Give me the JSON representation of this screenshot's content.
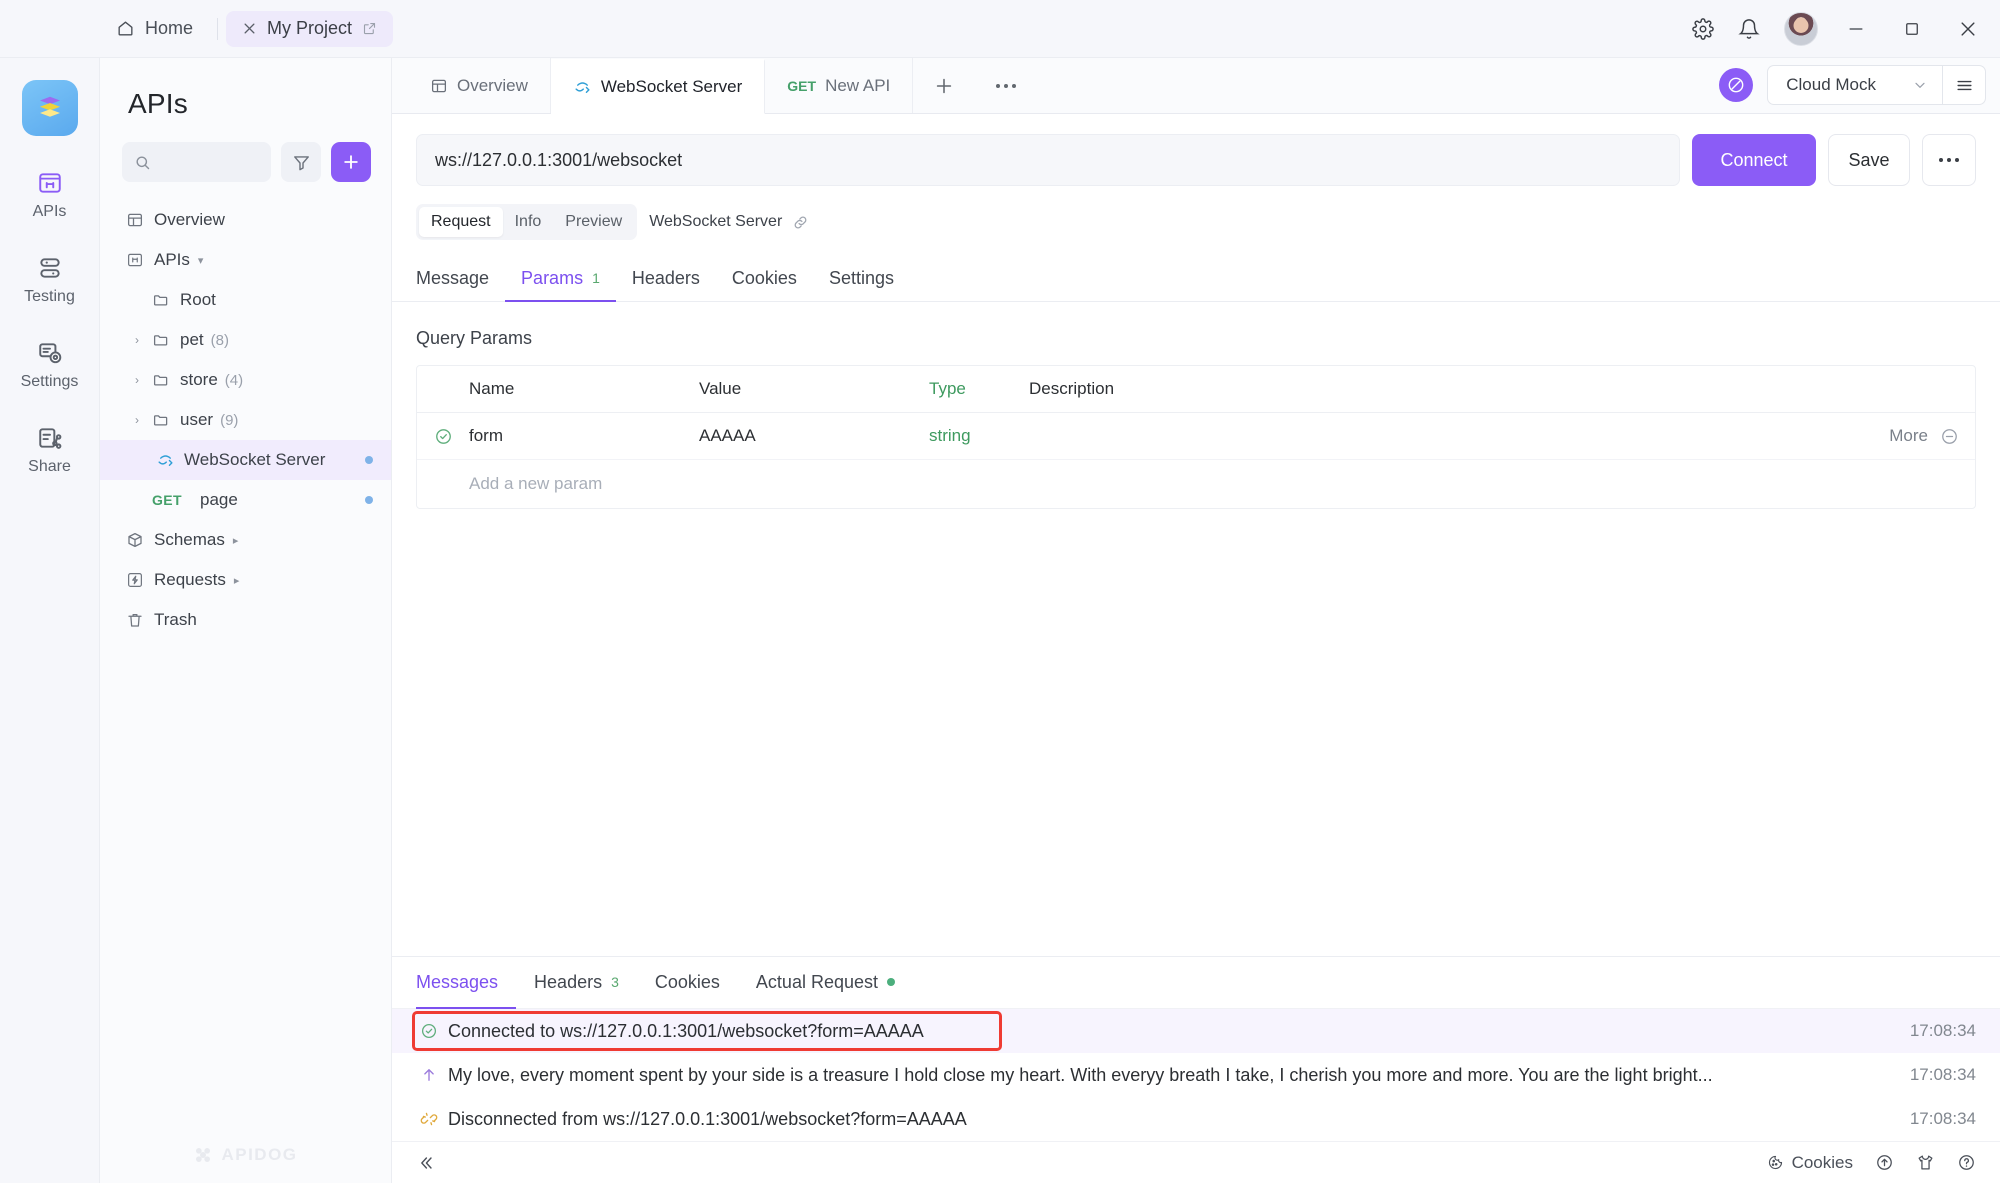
{
  "titlebar": {
    "home_label": "Home",
    "project_label": "My Project",
    "icons": {
      "home": "home-icon",
      "close_tab": "close-icon",
      "external_link": "external-link-icon",
      "settings": "gear-icon",
      "notifications": "bell-icon",
      "avatar": "user-avatar",
      "minimize": "minimize-icon",
      "maximize": "maximize-icon",
      "close": "close-icon"
    }
  },
  "rail": {
    "logo": "apidog-logo",
    "items": [
      {
        "label": "APIs",
        "icon": "apis-icon",
        "active": true
      },
      {
        "label": "Testing",
        "icon": "testing-icon",
        "active": false
      },
      {
        "label": "Settings",
        "icon": "settings-icon",
        "active": false
      },
      {
        "label": "Share",
        "icon": "share-icon",
        "active": false
      }
    ]
  },
  "sidebar": {
    "title": "APIs",
    "search_placeholder": "",
    "search_value": "",
    "filter_icon": "filter-icon",
    "add_icon": "plus-icon",
    "watermark": "APIDOG",
    "tree": [
      {
        "label": "Overview",
        "icon": "overview-icon",
        "indent": 0,
        "caret": "",
        "count": "",
        "selected": false,
        "dot": false
      },
      {
        "label": "APIs",
        "icon": "apis-icon",
        "indent": 0,
        "caret": "down-small",
        "count": "",
        "selected": false,
        "dot": false
      },
      {
        "label": "Root",
        "icon": "folder-icon",
        "indent": 1,
        "caret": "",
        "count": "",
        "selected": false,
        "dot": false
      },
      {
        "label": "pet",
        "icon": "folder-icon",
        "indent": 1,
        "caret": "right",
        "count": "(8)",
        "selected": false,
        "dot": false
      },
      {
        "label": "store",
        "icon": "folder-icon",
        "indent": 1,
        "caret": "right",
        "count": "(4)",
        "selected": false,
        "dot": false
      },
      {
        "label": "user",
        "icon": "folder-icon",
        "indent": 1,
        "caret": "right",
        "count": "(9)",
        "selected": false,
        "dot": false
      },
      {
        "label": "WebSocket Server",
        "icon": "websocket-icon",
        "indent": 2,
        "caret": "",
        "count": "",
        "selected": true,
        "dot": true
      },
      {
        "label": "page",
        "icon": "method-get",
        "indent": 2,
        "caret": "",
        "count": "",
        "selected": false,
        "dot": true,
        "method": "GET"
      },
      {
        "label": "Schemas",
        "icon": "schemas-icon",
        "indent": 0,
        "caret": "",
        "count": "",
        "selected": false,
        "dot": false,
        "arrow": "right-small"
      },
      {
        "label": "Requests",
        "icon": "requests-icon",
        "indent": 0,
        "caret": "",
        "count": "",
        "selected": false,
        "dot": false,
        "arrow": "right-small"
      },
      {
        "label": "Trash",
        "icon": "trash-icon",
        "indent": 0,
        "caret": "",
        "count": "",
        "selected": false,
        "dot": false
      }
    ]
  },
  "tabbar": {
    "tabs": [
      {
        "label": "Overview",
        "icon": "overview-icon",
        "method": "",
        "active": false
      },
      {
        "label": "WebSocket Server",
        "icon": "websocket-icon",
        "method": "",
        "active": true
      },
      {
        "label": "New API",
        "icon": "",
        "method": "GET",
        "active": false
      }
    ],
    "plus_icon": "plus-icon",
    "more_icon": "more-horizontal-icon",
    "mock_badge_icon": "mock-icon",
    "mock_label": "Cloud Mock",
    "mock_chevron": "chevron-down-icon",
    "menu_icon": "hamburger-icon"
  },
  "urlbar": {
    "url": "ws://127.0.0.1:3001/websocket",
    "url_placeholder": "ws://",
    "connect_label": "Connect",
    "save_label": "Save",
    "more_icon": "more-horizontal-icon"
  },
  "segmented": {
    "items": [
      {
        "label": "Request",
        "active": true
      },
      {
        "label": "Info",
        "active": false
      },
      {
        "label": "Preview",
        "active": false
      }
    ],
    "name": "WebSocket Server",
    "link_icon": "link-icon"
  },
  "subtabs": [
    {
      "label": "Message",
      "count": "",
      "active": false
    },
    {
      "label": "Params",
      "count": "1",
      "active": true
    },
    {
      "label": "Headers",
      "count": "",
      "active": false
    },
    {
      "label": "Cookies",
      "count": "",
      "active": false
    },
    {
      "label": "Settings",
      "count": "",
      "active": false
    }
  ],
  "params": {
    "section_title": "Query Params",
    "columns": [
      "Name",
      "Value",
      "Type",
      "Description"
    ],
    "rows": [
      {
        "checked": true,
        "check_icon": "check-circle-icon",
        "name": "form",
        "value": "AAAAA",
        "type": "string",
        "description": "",
        "more_label": "More",
        "remove_icon": "minus-circle-icon"
      }
    ],
    "add_row_placeholder": "Add a new param"
  },
  "bottom": {
    "tabs": [
      {
        "label": "Messages",
        "count": "",
        "dot": false,
        "active": true
      },
      {
        "label": "Headers",
        "count": "3",
        "dot": false,
        "active": false
      },
      {
        "label": "Cookies",
        "count": "",
        "dot": false,
        "active": false
      },
      {
        "label": "Actual Request",
        "count": "",
        "dot": true,
        "active": false
      }
    ],
    "messages": [
      {
        "icon": "check-circle-icon",
        "text": "Connected to ws://127.0.0.1:3001/websocket?form=AAAAA",
        "time": "17:08:34",
        "highlighted": true
      },
      {
        "icon": "arrow-up-icon",
        "text": "My love, every moment spent by your side is a treasure I hold close my heart. With everyy breath I take, I cherish you more and more. You are the light bright...",
        "time": "17:08:34",
        "highlighted": false
      },
      {
        "icon": "disconnected-icon",
        "text": "Disconnected from ws://127.0.0.1:3001/websocket?form=AAAAA",
        "time": "17:08:34",
        "highlighted": false
      }
    ]
  },
  "statusbar": {
    "collapse_icon": "collapse-left-icon",
    "cookies_label": "Cookies",
    "cookies_icon": "cookie-icon",
    "upload_icon": "upload-circle-icon",
    "shirt_icon": "theme-shirt-icon",
    "help_icon": "help-circle-icon"
  },
  "colors": {
    "accent": "#8b5cf6",
    "accent_text": "#7c50ef",
    "get_green": "#45a06a",
    "highlight_border": "#ef3b33",
    "highlight_bg": "#f7f4fe"
  }
}
